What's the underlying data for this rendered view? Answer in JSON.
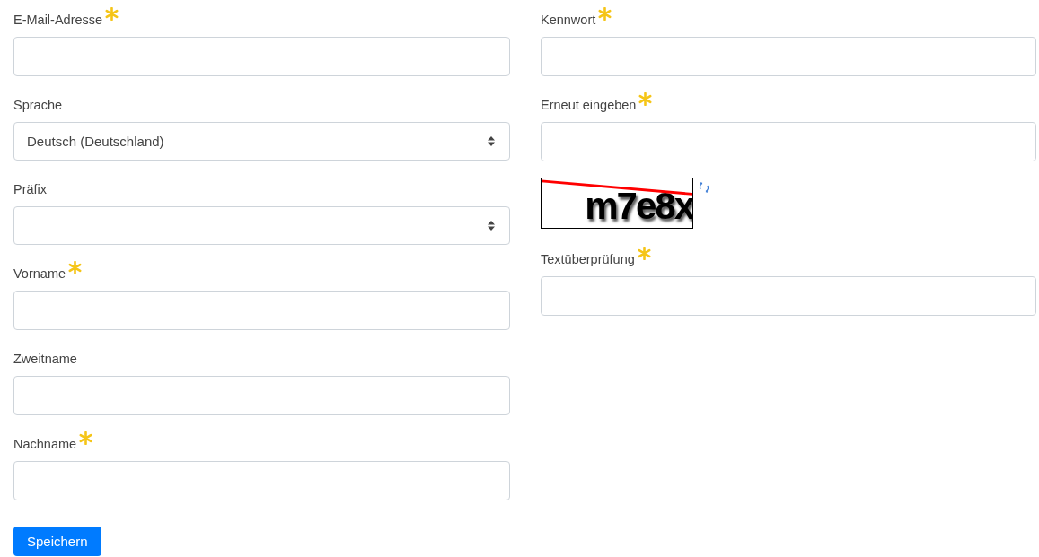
{
  "left_fields": [
    {
      "kind": "text",
      "label": "E-Mail-Adresse",
      "required": true
    },
    {
      "kind": "select",
      "label": "Sprache",
      "required": false,
      "value": "Deutsch (Deutschland)"
    },
    {
      "kind": "select",
      "label": "Präfix",
      "required": false
    },
    {
      "kind": "text",
      "label": "Vorname",
      "required": true
    },
    {
      "kind": "text",
      "label": "Zweitname",
      "required": false
    },
    {
      "kind": "text",
      "label": "Nachname",
      "required": true
    }
  ],
  "right_fields": [
    {
      "kind": "text",
      "label": "Kennwort",
      "required": true
    },
    {
      "kind": "text",
      "label": "Erneut eingeben",
      "required": true
    },
    {
      "kind": "captcha",
      "captcha_text": "m7e8x"
    },
    {
      "kind": "text",
      "label": "Textüberprüfung",
      "required": true
    }
  ],
  "save_button": "Speichern"
}
